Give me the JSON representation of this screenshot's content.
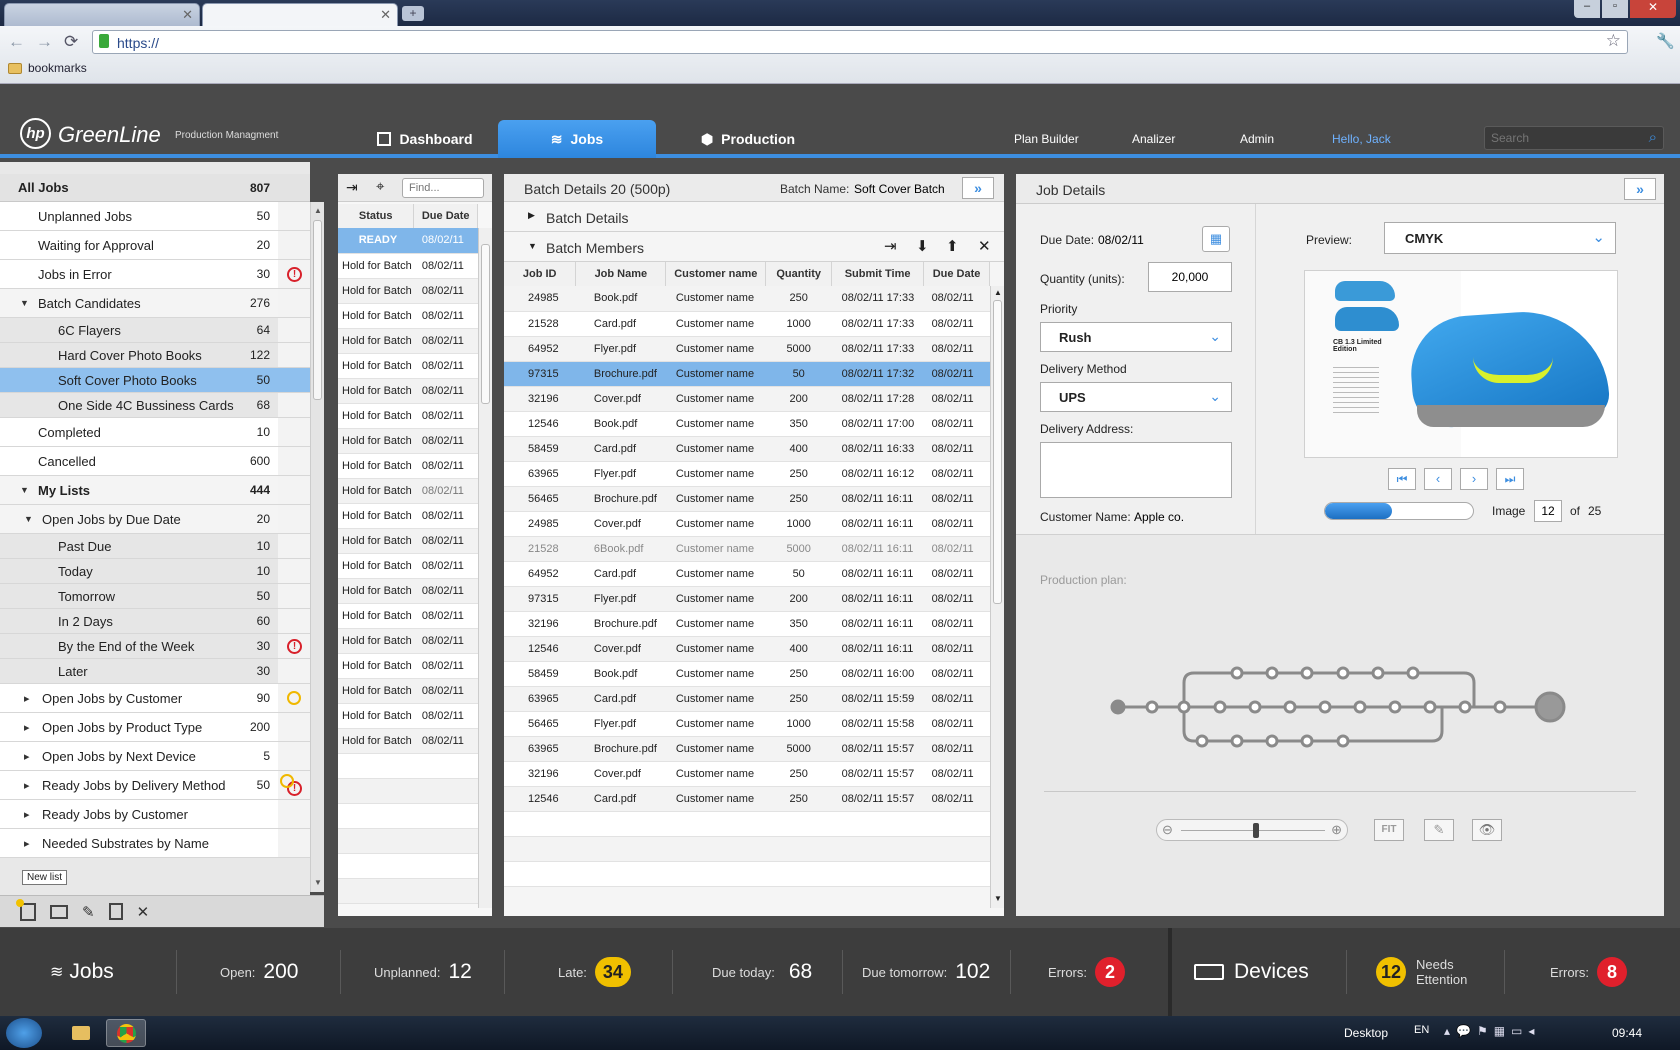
{
  "browser": {
    "url": "https://",
    "bookmarks": "bookmarks"
  },
  "app": {
    "logo": "hp",
    "name": "GreenLine",
    "subtitle": "Production Managment",
    "tabs": [
      {
        "label": "Dashboard",
        "icon": "dashboard-icon"
      },
      {
        "label": "Jobs",
        "icon": "layers-icon",
        "active": true
      },
      {
        "label": "Production",
        "icon": "box-icon"
      }
    ],
    "links": [
      "Plan Builder",
      "Analizer",
      "Admin"
    ],
    "greeting": "Hello, Jack",
    "search_placeholder": "Search"
  },
  "sidebar": {
    "all_jobs": {
      "label": "All Jobs",
      "count": "807"
    },
    "items": [
      {
        "label": "Unplanned Jobs",
        "count": "50"
      },
      {
        "label": "Waiting for Approval",
        "count": "20"
      },
      {
        "label": "Jobs in Error",
        "count": "30",
        "status": "error"
      },
      {
        "label": "Batch Candidates",
        "count": "276",
        "expanded": true
      },
      {
        "label": "6C Flayers",
        "count": "64"
      },
      {
        "label": "Hard Cover Photo Books",
        "count": "122"
      },
      {
        "label": "Soft Cover Photo Books",
        "count": "50",
        "selected": true
      },
      {
        "label": "One Side 4C Bussiness Cards",
        "count": "68"
      },
      {
        "label": "Completed",
        "count": "10"
      },
      {
        "label": "Cancelled",
        "count": "600"
      },
      {
        "label": "My Lists",
        "count": "444",
        "expanded": true
      },
      {
        "label": "Open Jobs by Due Date",
        "count": "20",
        "expanded": true
      },
      {
        "label": "Past Due",
        "count": "10"
      },
      {
        "label": "Today",
        "count": "10"
      },
      {
        "label": "Tomorrow",
        "count": "50"
      },
      {
        "label": "In 2 Days",
        "count": "60"
      },
      {
        "label": "By the End of the Week",
        "count": "30",
        "status": "error"
      },
      {
        "label": "Later",
        "count": "30"
      },
      {
        "label": "Open Jobs by Customer",
        "count": "90",
        "status": "clock"
      },
      {
        "label": "Open Jobs by Product Type",
        "count": "200"
      },
      {
        "label": "Open Jobs by Next Device",
        "count": "5"
      },
      {
        "label": "Ready Jobs by Delivery Method",
        "count": "50",
        "status": "clock-error"
      },
      {
        "label": "Ready Jobs by Customer",
        "count": ""
      },
      {
        "label": "Needed Substrates by Name",
        "count": ""
      }
    ],
    "tooltip": "New list"
  },
  "batches": {
    "find_placeholder": "Find...",
    "col_status": "Status",
    "col_due": "Due Date",
    "rows": [
      {
        "status": "READY",
        "due": "08/02/11"
      },
      {
        "status": "Hold for Batch",
        "due": "08/02/11"
      },
      {
        "status": "Hold for Batch",
        "due": "08/02/11"
      },
      {
        "status": "Hold for Batch",
        "due": "08/02/11"
      },
      {
        "status": "Hold for Batch",
        "due": "08/02/11"
      },
      {
        "status": "Hold for Batch",
        "due": "08/02/11"
      },
      {
        "status": "Hold for Batch",
        "due": "08/02/11"
      },
      {
        "status": "Hold for Batch",
        "due": "08/02/11"
      },
      {
        "status": "Hold for Batch",
        "due": "08/02/11"
      },
      {
        "status": "Hold for Batch",
        "due": "08/02/11"
      },
      {
        "status": "Hold for Batch",
        "due": "08/02/11"
      },
      {
        "status": "Hold for Batch",
        "due": "08/02/11"
      },
      {
        "status": "Hold for Batch",
        "due": "08/02/11"
      },
      {
        "status": "Hold for Batch",
        "due": "08/02/11"
      },
      {
        "status": "Hold for Batch",
        "due": "08/02/11"
      },
      {
        "status": "Hold for Batch",
        "due": "08/02/11"
      },
      {
        "status": "Hold for Batch",
        "due": "08/02/11"
      },
      {
        "status": "Hold for Batch",
        "due": "08/02/11"
      },
      {
        "status": "Hold for Batch",
        "due": "08/02/11"
      },
      {
        "status": "Hold for Batch",
        "due": "08/02/11"
      },
      {
        "status": "Hold for Batch",
        "due": "08/02/11"
      }
    ]
  },
  "batch": {
    "title": "Batch Details 20 (500p)",
    "name_label": "Batch Name:",
    "name": "Soft Cover Batch",
    "details_label": "Batch Details",
    "members_label": "Batch Members",
    "cols": [
      "Job ID",
      "Job Name",
      "Customer name",
      "Quantity",
      "Submit Time",
      "Due Date"
    ],
    "rows": [
      [
        "24985",
        "Book.pdf",
        "Customer name",
        "250",
        "08/02/11 17:33",
        "08/02/11"
      ],
      [
        "21528",
        "Card.pdf",
        "Customer name",
        "1000",
        "08/02/11 17:33",
        "08/02/11"
      ],
      [
        "64952",
        "Flyer.pdf",
        "Customer name",
        "5000",
        "08/02/11 17:33",
        "08/02/11"
      ],
      [
        "97315",
        "Brochure.pdf",
        "Customer name",
        "50",
        "08/02/11 17:32",
        "08/02/11"
      ],
      [
        "32196",
        "Cover.pdf",
        "Customer name",
        "200",
        "08/02/11 17:28",
        "08/02/11"
      ],
      [
        "12546",
        "Book.pdf",
        "Customer name",
        "350",
        "08/02/11 17:00",
        "08/02/11"
      ],
      [
        "58459",
        "Card.pdf",
        "Customer name",
        "400",
        "08/02/11 16:33",
        "08/02/11"
      ],
      [
        "63965",
        "Flyer.pdf",
        "Customer name",
        "250",
        "08/02/11 16:12",
        "08/02/11"
      ],
      [
        "56465",
        "Brochure.pdf",
        "Customer name",
        "250",
        "08/02/11 16:11",
        "08/02/11"
      ],
      [
        "24985",
        "Cover.pdf",
        "Customer name",
        "1000",
        "08/02/11 16:11",
        "08/02/11"
      ],
      [
        "21528",
        "6Book.pdf",
        "Customer name",
        "5000",
        "08/02/11 16:11",
        "08/02/11"
      ],
      [
        "64952",
        "Card.pdf",
        "Customer name",
        "50",
        "08/02/11 16:11",
        "08/02/11"
      ],
      [
        "97315",
        "Flyer.pdf",
        "Customer name",
        "200",
        "08/02/11 16:11",
        "08/02/11"
      ],
      [
        "32196",
        "Brochure.pdf",
        "Customer name",
        "350",
        "08/02/11 16:11",
        "08/02/11"
      ],
      [
        "12546",
        "Cover.pdf",
        "Customer name",
        "400",
        "08/02/11 16:11",
        "08/02/11"
      ],
      [
        "58459",
        "Book.pdf",
        "Customer name",
        "250",
        "08/02/11 16:00",
        "08/02/11"
      ],
      [
        "63965",
        "Card.pdf",
        "Customer name",
        "250",
        "08/02/11 15:59",
        "08/02/11"
      ],
      [
        "56465",
        "Flyer.pdf",
        "Customer name",
        "1000",
        "08/02/11 15:58",
        "08/02/11"
      ],
      [
        "63965",
        "Brochure.pdf",
        "Customer name",
        "5000",
        "08/02/11 15:57",
        "08/02/11"
      ],
      [
        "32196",
        "Cover.pdf",
        "Customer name",
        "250",
        "08/02/11 15:57",
        "08/02/11"
      ],
      [
        "12546",
        "Card.pdf",
        "Customer name",
        "250",
        "08/02/11 15:57",
        "08/02/11"
      ]
    ]
  },
  "job": {
    "title": "Job Details",
    "due_label": "Due Date:",
    "due": "08/02/11",
    "qty_label": "Quantity (units):",
    "qty": "20,000",
    "priority_label": "Priority",
    "priority": "Rush",
    "delivery_label": "Delivery Method",
    "delivery": "UPS",
    "address_label": "Delivery Address:",
    "customer_label": "Customer Name:",
    "customer": "Apple co.",
    "preview_label": "Preview:",
    "preview": "CMYK",
    "image_label": "Image",
    "image_num": "12",
    "of_label": "of",
    "image_total": "25",
    "preview_text": "CB 1.3 Limited Edition",
    "progress": 0.45,
    "plan_label": "Production plan:",
    "fit_label": "FIT"
  },
  "status": {
    "jobs_label": "Jobs",
    "open_label": "Open:",
    "open": "200",
    "unplanned_label": "Unplanned:",
    "unplanned": "12",
    "late_label": "Late:",
    "late": "34",
    "today_label": "Due today:",
    "today": "68",
    "tomorrow_label": "Due tomorrow:",
    "tomorrow": "102",
    "errors_label": "Errors:",
    "errors": "2",
    "devices_label": "Devices",
    "needs": "12",
    "needs_label_1": "Needs",
    "needs_label_2": "Ettention",
    "dev_errors_label": "Errors:",
    "dev_errors": "8"
  },
  "taskbar": {
    "desktop": "Desktop",
    "lang": "EN",
    "time": "09:44"
  },
  "colors": {
    "accent": "#3d8ee0",
    "selected": "#7fb6ea",
    "error": "#d8202a",
    "warn": "#f0b800"
  }
}
